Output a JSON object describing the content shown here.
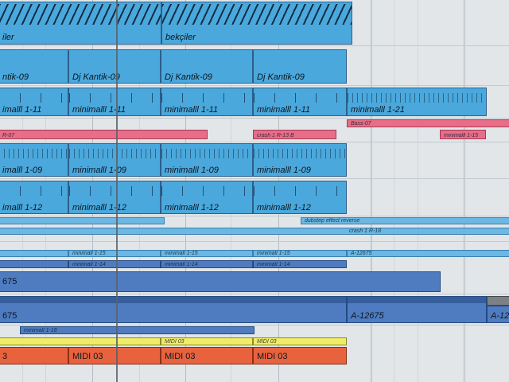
{
  "tracks": {
    "bekciler": {
      "clip1": "iler",
      "clip2": "bekçiler"
    },
    "djkantik": {
      "clip1": "ntik-09",
      "clip2": "Dj Kantik-09",
      "clip3": "Dj Kantik-09",
      "clip4": "Dj Kantik-09"
    },
    "minimal11": {
      "clip1": "imalll 1-11",
      "clip2": "minimalll 1-11",
      "clip3": "minimalll 1-11",
      "clip4": "minimalll 1-11",
      "clip5": "minimalll 1-21"
    },
    "crash": {
      "clip1": "R-07",
      "clip2": "crash 1 R-13 B",
      "clip3": "Bass-07",
      "clip4": "minimalll 1-15"
    },
    "minimal09": {
      "clip1": "imalll 1-09",
      "clip2": "minimalll 1-09",
      "clip3": "minimalll 1-09",
      "clip4": "minimalll 1-09"
    },
    "minimal12": {
      "clip1": "imalll 1-12",
      "clip2": "minimalll 1-12",
      "clip3": "minimalll 1-12",
      "clip4": "minimalll 1-12"
    },
    "thin1": {
      "clip1": "dubstep effect reverse"
    },
    "thin2": {
      "clip1": "crash 1 R-18"
    },
    "thin3": {
      "clip1": "minimall 1-15",
      "clip2": "minimall 1-15",
      "clip3": "minimall 1-15",
      "clip4": "A-12675"
    },
    "thin4": {
      "clip1": "minimall 1-14",
      "clip2": "minimall 1-14",
      "clip3": "minimall 1-14"
    },
    "a12675": {
      "clip1": "675"
    },
    "a12675b": {
      "clip1": "675",
      "clip2": "A-12675",
      "clip3": "A-12"
    },
    "thin5": {
      "clip1": "minimall 1-18"
    },
    "yellow": {
      "clip1": "MIDI 03",
      "clip2": "MIDI 03"
    },
    "midi": {
      "clip1": "3",
      "clip2": "MIDI 03",
      "clip3": "MIDI 03",
      "clip4": "MIDI 03"
    }
  }
}
